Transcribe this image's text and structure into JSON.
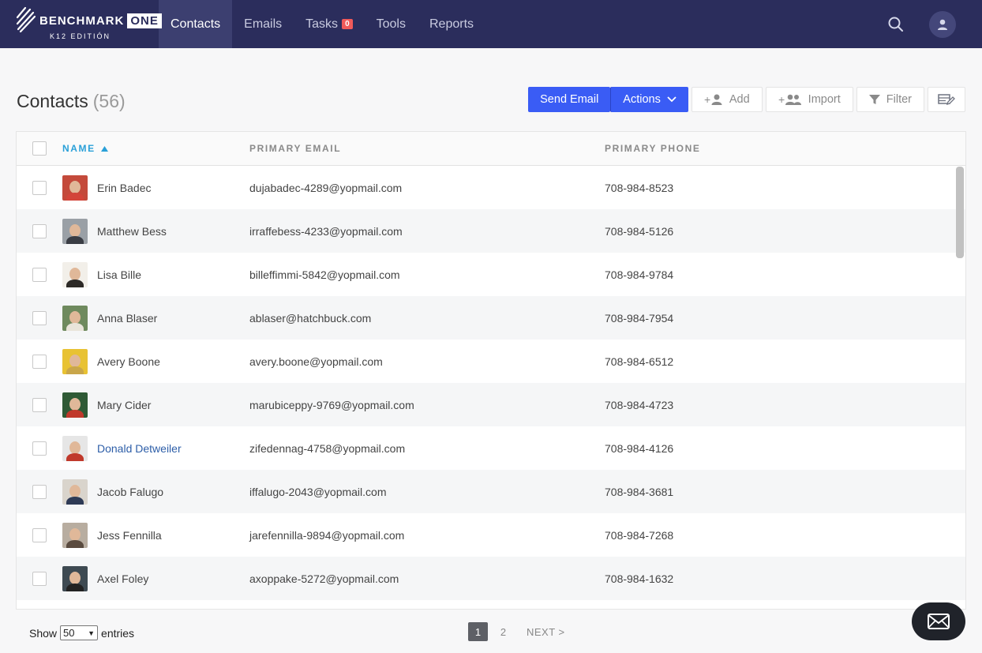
{
  "brand": {
    "name": "BENCHMARK",
    "badge": "ONE",
    "edition": "K12 EDITIÓN"
  },
  "nav": [
    {
      "label": "Contacts",
      "active": true
    },
    {
      "label": "Emails"
    },
    {
      "label": "Tasks",
      "badge": "0"
    },
    {
      "label": "Tools"
    },
    {
      "label": "Reports"
    }
  ],
  "page": {
    "title": "Contacts",
    "count": "(56)"
  },
  "toolbar": {
    "send_email": "Send Email",
    "actions": "Actions",
    "add": "Add",
    "import": "Import",
    "filter": "Filter"
  },
  "table": {
    "headers": {
      "name": "NAME",
      "email": "PRIMARY EMAIL",
      "phone": "PRIMARY PHONE"
    },
    "rows": [
      {
        "name": "Erin Badec",
        "email": "dujabadec-4289@yopmail.com",
        "phone": "708-984-8523",
        "avatar_bg": "#c44a3b",
        "avatar_body": "#d3453a"
      },
      {
        "name": "Matthew Bess",
        "email": "irraffebess-4233@yopmail.com",
        "phone": "708-984-5126",
        "avatar_bg": "#9aa0a6",
        "avatar_body": "#3a3d44"
      },
      {
        "name": "Lisa Bille",
        "email": "billeffimmi-5842@yopmail.com",
        "phone": "708-984-9784",
        "avatar_bg": "#f2efe9",
        "avatar_body": "#2d2a27"
      },
      {
        "name": "Anna Blaser",
        "email": "ablaser@hatchbuck.com",
        "phone": "708-984-7954",
        "avatar_bg": "#6f8a5e",
        "avatar_body": "#e9e4da"
      },
      {
        "name": "Avery Boone",
        "email": "avery.boone@yopmail.com",
        "phone": "708-984-6512",
        "avatar_bg": "#e8c233",
        "avatar_body": "#c9a64a"
      },
      {
        "name": "Mary Cider",
        "email": "marubiceppy-9769@yopmail.com",
        "phone": "708-984-4723",
        "avatar_bg": "#2f5a35",
        "avatar_body": "#c0392b"
      },
      {
        "name": "Donald Detweiler",
        "email": "zifedennag-4758@yopmail.com",
        "phone": "708-984-4126",
        "avatar_bg": "#e6e6e6",
        "avatar_body": "#c0392b",
        "link": true
      },
      {
        "name": "Jacob Falugo",
        "email": "iffalugo-2043@yopmail.com",
        "phone": "708-984-3681",
        "avatar_bg": "#d9d4cc",
        "avatar_body": "#2e3a55"
      },
      {
        "name": "Jess Fennilla",
        "email": "jarefennilla-9894@yopmail.com",
        "phone": "708-984-7268",
        "avatar_bg": "#b8ada0",
        "avatar_body": "#5a4b3f"
      },
      {
        "name": "Axel Foley",
        "email": "axoppake-5272@yopmail.com",
        "phone": "708-984-1632",
        "avatar_bg": "#3e4a52",
        "avatar_body": "#222"
      }
    ]
  },
  "footer": {
    "show_label": "Show",
    "entries_value": "50",
    "entries_label": "entries",
    "pages": [
      "1",
      "2"
    ],
    "next": "NEXT >"
  }
}
